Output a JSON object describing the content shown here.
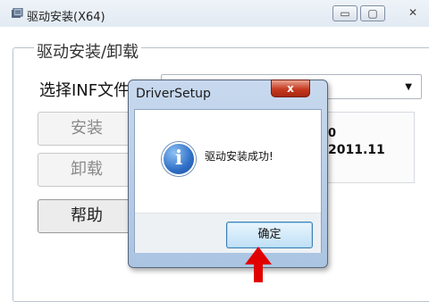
{
  "window": {
    "title": "驱动安装(X64)",
    "controls": {
      "minimize": "▭",
      "maximize": "▢",
      "close": "✕"
    }
  },
  "group": {
    "title": "驱动安装/卸载",
    "inf_label": "选择INF文件",
    "inf_selected": ""
  },
  "buttons": {
    "install": "安装",
    "uninstall": "卸载",
    "help": "帮助"
  },
  "info": {
    "line1": "0",
    "line2": "2011.11"
  },
  "dialog": {
    "title": "DriverSetup",
    "close": "x",
    "message": "驱动安装成功!",
    "icon_glyph": "i",
    "ok": "确定"
  },
  "colors": {
    "dialog_close": "#c53a20",
    "ok_button_border": "#3c7fb1",
    "annotation_arrow": "#e00000"
  }
}
